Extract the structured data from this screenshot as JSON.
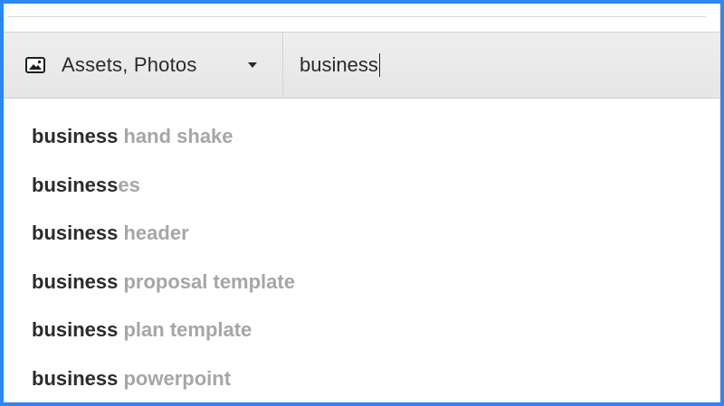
{
  "search_bar": {
    "scope_icon": "image-icon",
    "scope_label": "Assets, Photos",
    "dropdown_icon": "caret-down-icon",
    "query": "business"
  },
  "suggestions": [
    {
      "match": "business",
      "rest": " hand shake"
    },
    {
      "match": "business",
      "rest": "es"
    },
    {
      "match": "business",
      "rest": " header"
    },
    {
      "match": "business",
      "rest": " proposal template"
    },
    {
      "match": "business",
      "rest": " plan template"
    },
    {
      "match": "business",
      "rest": " powerpoint"
    }
  ],
  "colors": {
    "frame_border": "#2f86f0",
    "bar_background": "#eeeeee",
    "match_text": "#2b2b2b",
    "rest_text": "#a6a6a6"
  }
}
